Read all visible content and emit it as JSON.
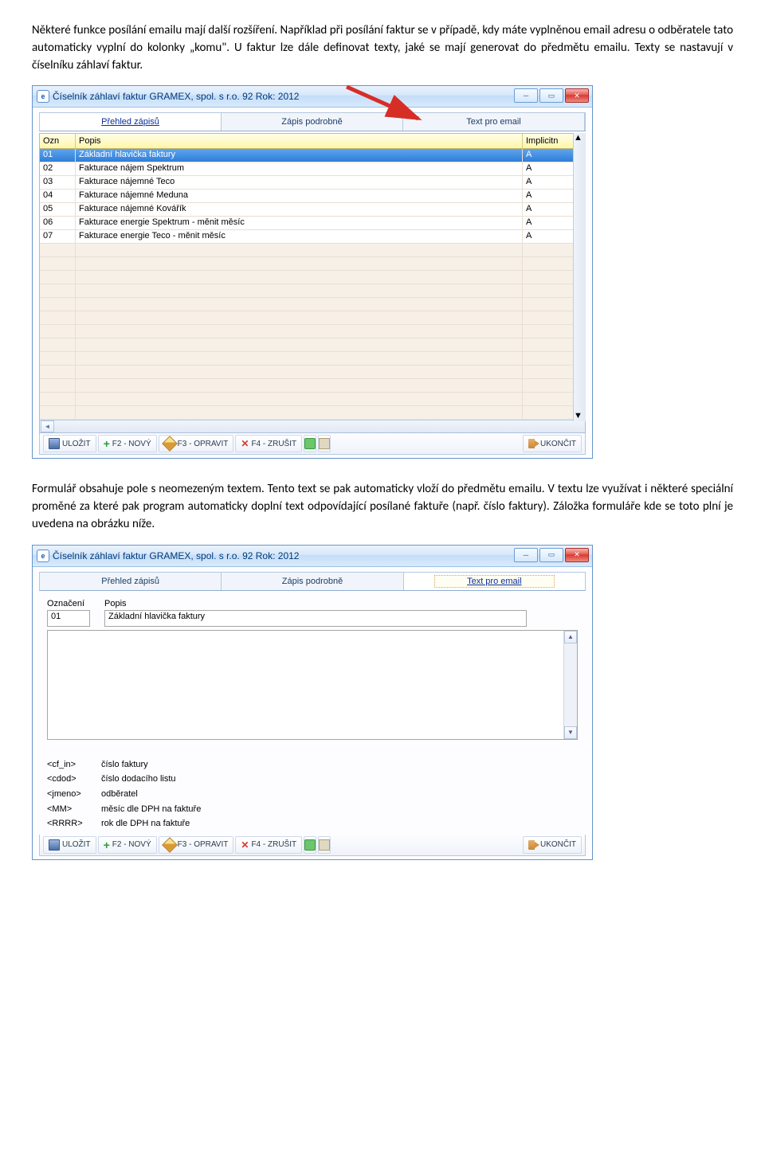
{
  "paragraphs": {
    "p1": "Některé funkce posílání emailu mají další rozšíření. Například při posílání faktur se v případě, kdy máte vyplněnou email adresu o odběratele tato automaticky vyplní do kolonky „komu\". U faktur lze dále definovat texty, jaké se mají generovat do předmětu emailu. Texty se nastavují v číselníku záhlaví faktur.",
    "p2": "Formulář obsahuje pole s neomezeným textem. Tento text se pak automaticky vloží do předmětu emailu. V textu lze využívat i některé speciální proměné za které pak program automaticky doplní text odpovídající posílané faktuře (např. číslo faktury). Záložka formuláře kde se toto plní je uvedena na obrázku níže."
  },
  "window": {
    "app_icon_letter": "e",
    "title": "Číselník záhlaví faktur  GRAMEX, spol. s r.o.         92  Rok: 2012",
    "tabs": {
      "prehled": "Přehled zápisů",
      "zapis": "Zápis podrobně",
      "textemail": "Text pro email"
    },
    "grid": {
      "hdr_ozn": "Ozn",
      "hdr_popis": "Popis",
      "hdr_imp": "Implicitn",
      "rows": [
        {
          "ozn": "01",
          "popis": "Základní hlavička faktury",
          "imp": "A",
          "selected": true
        },
        {
          "ozn": "02",
          "popis": "Fakturace nájem Spektrum",
          "imp": "A"
        },
        {
          "ozn": "03",
          "popis": "Fakturace nájemné Teco",
          "imp": "A"
        },
        {
          "ozn": "04",
          "popis": "Fakturace nájemné Meduna",
          "imp": "A"
        },
        {
          "ozn": "05",
          "popis": "Fakturace nájemné Kovářík",
          "imp": "A"
        },
        {
          "ozn": "06",
          "popis": "Fakturace energie Spektrum - měnit měsíc",
          "imp": "A"
        },
        {
          "ozn": "07",
          "popis": "Fakturace energie Teco - měnit měsíc",
          "imp": "A"
        }
      ]
    }
  },
  "toolbar": {
    "save": "ULOŽIT",
    "new": "F2 - NOVÝ",
    "edit": "F3 - OPRAVIT",
    "delete": "F4 - ZRUŠIT",
    "end": "UKONČIT"
  },
  "form": {
    "lbl_ozn": "Označení",
    "lbl_popis": "Popis",
    "val_ozn": "01",
    "val_popis": "Základní hlavička faktury"
  },
  "legend": [
    {
      "k": "<cf_in>",
      "v": "číslo faktury"
    },
    {
      "k": "<cdod>",
      "v": "číslo dodacího listu"
    },
    {
      "k": "<jmeno>",
      "v": "odběratel"
    },
    {
      "k": "<MM>",
      "v": "měsíc dle DPH na faktuře"
    },
    {
      "k": "<RRRR>",
      "v": "rok dle DPH na faktuře"
    }
  ]
}
